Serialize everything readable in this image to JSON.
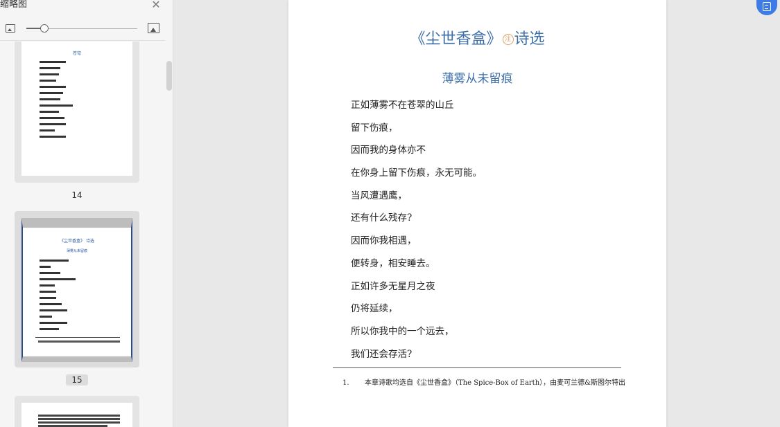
{
  "sidebar": {
    "title": "缩略图",
    "close_icon": "close-icon",
    "thumbnails": [
      {
        "number": "14",
        "title": "苍穹",
        "lines": [
          "",
          "",
          "",
          "",
          "",
          "",
          "",
          "",
          "",
          "",
          "",
          ""
        ]
      },
      {
        "number": "15",
        "title": "《尘世香盒》 诗选",
        "subtitle": "薄雾从未留痕",
        "selected": true
      },
      {
        "number": ""
      }
    ]
  },
  "document": {
    "title_prefix": "《尘世香盒》",
    "note_mark": "注",
    "title_suffix": "诗选",
    "subtitle": "薄雾从未留痕",
    "poem": [
      "正如薄雾不在苍翠的山丘",
      "留下伤痕，",
      "因而我的身体亦不",
      "在你身上留下伤痕，永无可能。",
      "当风遭遇鹰，",
      "还有什么残存?",
      "因而你我相遇，",
      "便转身，相安睡去。",
      "正如许多无星月之夜",
      "仍将延续，",
      "所以你我中的一个远去，",
      "我们还会存活?"
    ],
    "footnote_number": "1.",
    "footnote_text": "本章诗歌均选自《尘世香盒》（The Spice-Box of Earth），由麦可兰德&斯图尔特出"
  },
  "colors": {
    "title": "#3e6fa8",
    "accent": "#3d7be6",
    "note": "#e0a060"
  }
}
